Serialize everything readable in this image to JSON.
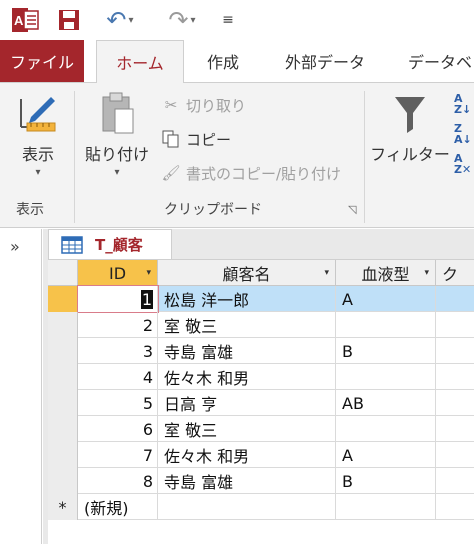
{
  "qat": {
    "app_logo": "A",
    "redo_more": "▾",
    "undo_more": "▾",
    "customize": "≡"
  },
  "tabs": {
    "file": "ファイル",
    "home": "ホーム",
    "create": "作成",
    "external": "外部データ",
    "db": "データベ"
  },
  "ribbon": {
    "views_btn": "表示",
    "views_group": "表示",
    "paste_btn": "貼り付け",
    "cut": "切り取り",
    "copy": "コピー",
    "format_painter": "書式のコピー/貼り付け",
    "clipboard_group": "クリップボード",
    "filter_btn": "フィルター",
    "dropdown_arrow": "▾"
  },
  "nav": {
    "toggle": "»"
  },
  "document": {
    "tab_label": "T_顧客",
    "columns": [
      "ID",
      "顧客名",
      "血液型",
      "ク"
    ],
    "rows": [
      {
        "id": "1",
        "name": "松島 洋一郎",
        "blood": "A"
      },
      {
        "id": "2",
        "name": "室 敬三",
        "blood": ""
      },
      {
        "id": "3",
        "name": "寺島 富雄",
        "blood": "B"
      },
      {
        "id": "4",
        "name": "佐々木 和男",
        "blood": ""
      },
      {
        "id": "5",
        "name": "日高 亨",
        "blood": "AB"
      },
      {
        "id": "6",
        "name": "室 敬三",
        "blood": ""
      },
      {
        "id": "7",
        "name": "佐々木 和男",
        "blood": "A"
      },
      {
        "id": "8",
        "name": "寺島 富雄",
        "blood": "B"
      }
    ],
    "new_row_marker": "*",
    "new_row_label": "(新規)"
  },
  "colors": {
    "accent": "#a4262c",
    "selected_row": "#bfe0f8",
    "active_header": "#f7c24a"
  }
}
